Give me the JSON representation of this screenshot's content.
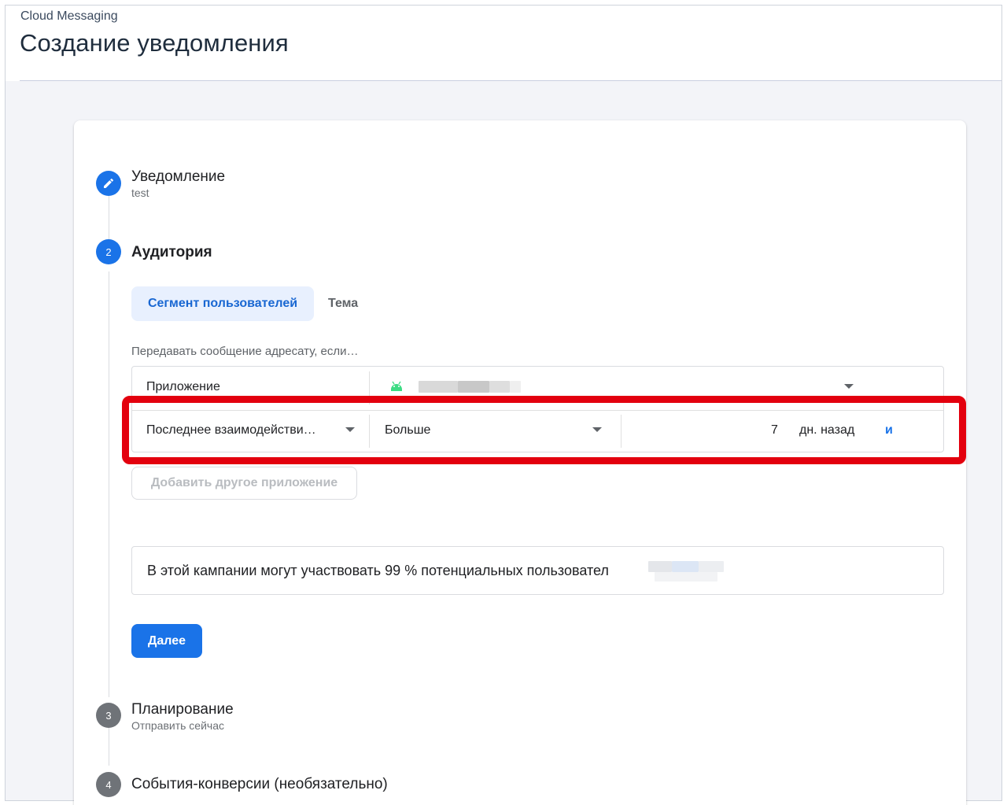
{
  "header": {
    "product": "Cloud Messaging",
    "title": "Создание уведомления"
  },
  "steps": [
    {
      "number": "",
      "icon": "pencil-icon",
      "title": "Уведомление",
      "subtitle": "test",
      "state": "completed"
    },
    {
      "number": "2",
      "title": "Аудитория",
      "state": "active"
    },
    {
      "number": "3",
      "title": "Планирование",
      "subtitle": "Отправить сейчас",
      "state": "pending"
    },
    {
      "number": "4",
      "title": "События-конверсии (необязательно)",
      "state": "pending"
    }
  ],
  "audience": {
    "tabs": [
      {
        "label": "Сегмент пользователей",
        "active": true
      },
      {
        "label": "Тема",
        "active": false
      }
    ],
    "hint": "Передавать сообщение адресату, если…",
    "app_row": {
      "label": "Приложение",
      "icon": "android-icon"
    },
    "condition_row": {
      "field": "Последнее взаимодействи…",
      "operator": "Больше",
      "value": "7",
      "unit": "дн. назад",
      "conjunction": "и"
    },
    "add_app_label": "Добавить другое приложение",
    "estimate_text": "В этой кампании могут участвовать 99 % потенциальных пользовател",
    "next_label": "Далее"
  },
  "colors": {
    "primary": "#1a73e8",
    "highlight": "#e3000e",
    "tab_active_bg": "#e8f0fe"
  }
}
